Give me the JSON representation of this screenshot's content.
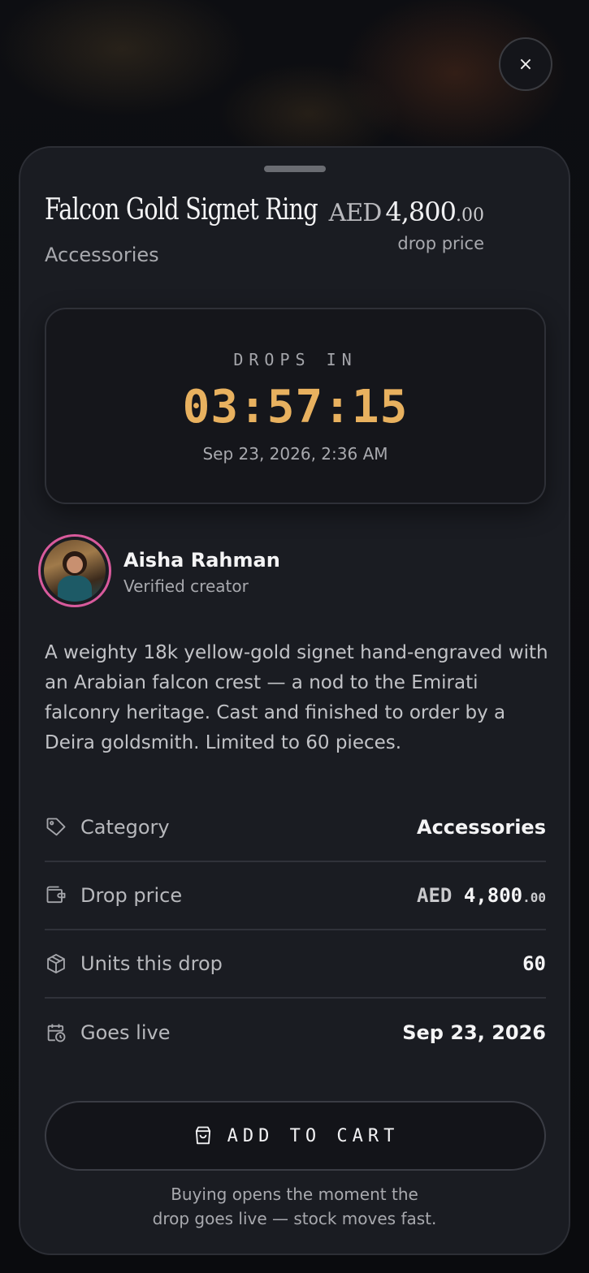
{
  "close_label": "×",
  "product": {
    "title": "Falcon Gold Signet Ring",
    "category": "Accessories",
    "price_currency": "AED",
    "price_amount": "4,800",
    "price_decimals": ".00",
    "price_note": "drop price"
  },
  "countdown": {
    "label": "DROPS IN",
    "time": "03:57:15",
    "date": "Sep 23, 2026, 2:36 AM"
  },
  "creator": {
    "name": "Aisha Rahman",
    "role": "Verified creator"
  },
  "description": "A weighty 18k yellow-gold signet hand-engraved with an Arabian falcon crest — a nod to the Emirati falconry heritage. Cast and finished to order by a Deira goldsmith. Limited to 60 pieces.",
  "specs": {
    "category": {
      "label": "Category",
      "value": "Accessories",
      "icon": "tag-icon"
    },
    "drop_price": {
      "label": "Drop price",
      "currency": "AED",
      "amount": "4,800",
      "decimals": ".00",
      "icon": "wallet-icon"
    },
    "units": {
      "label": "Units this drop",
      "value": "60",
      "icon": "box-icon"
    },
    "goes_live": {
      "label": "Goes live",
      "value": "Sep 23, 2026",
      "icon": "calendar-clock-icon"
    }
  },
  "cart": {
    "label": "ADD TO CART",
    "icon": "shopping-bag-icon"
  },
  "footnote": {
    "line1": "Buying opens the moment the",
    "line2": "drop goes live — stock moves fast."
  },
  "colors": {
    "accent_gold": "#e8b15f",
    "avatar_ring": "#d85a9c",
    "sheet_bg": "#1a1c22"
  }
}
